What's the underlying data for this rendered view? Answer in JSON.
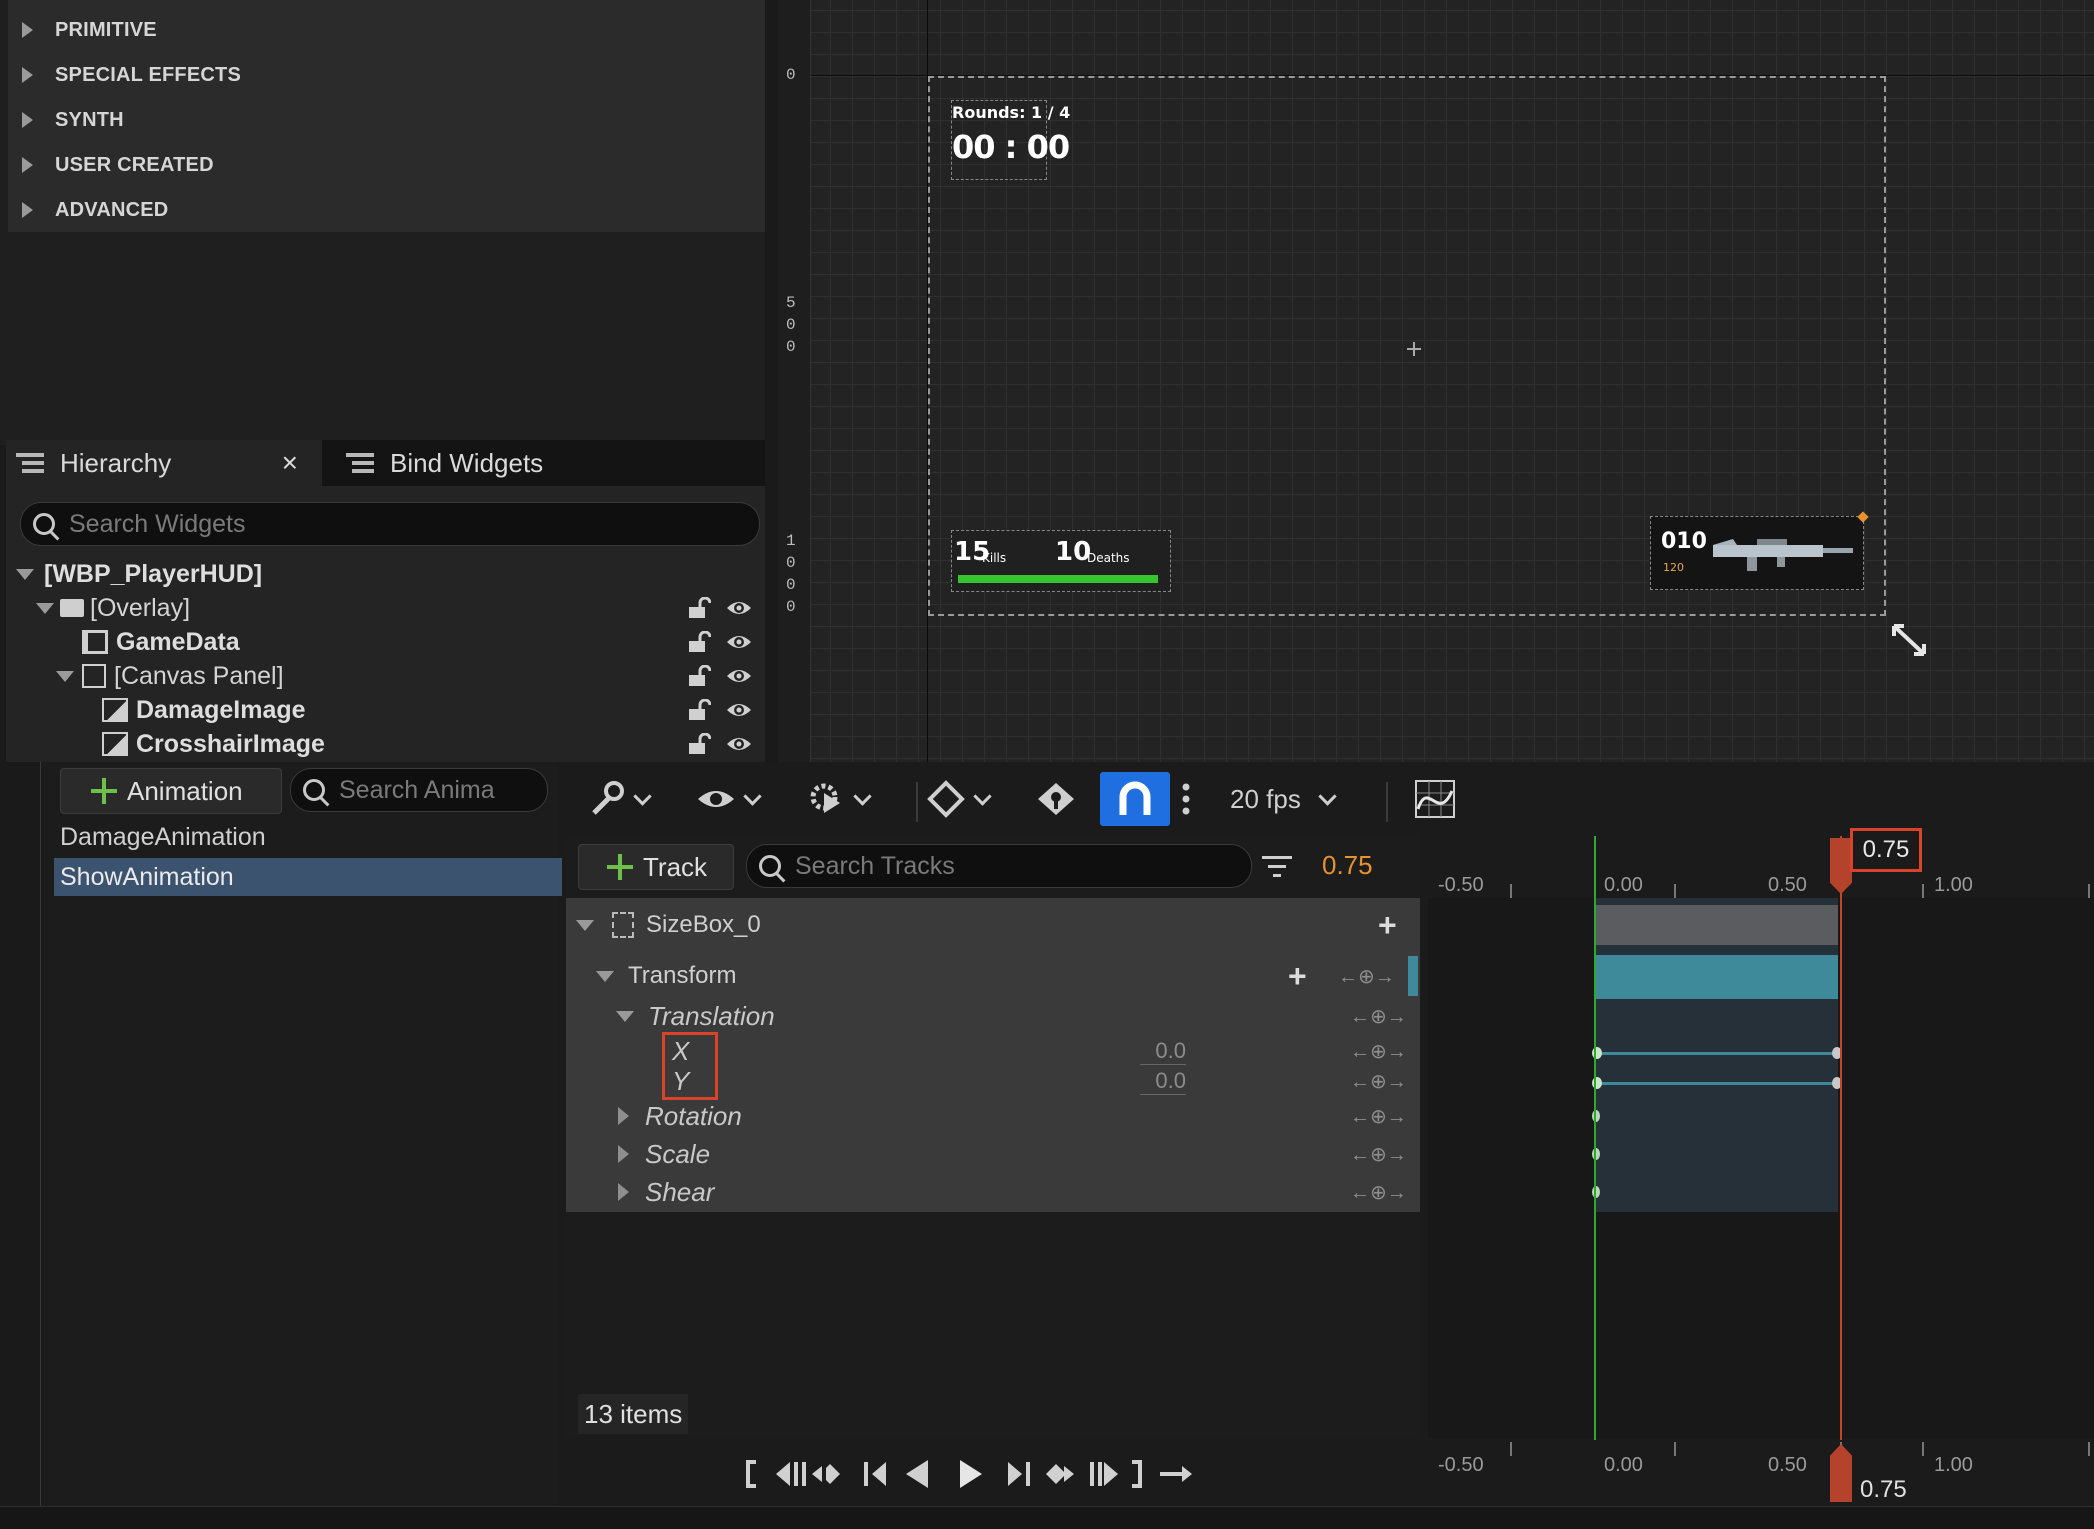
{
  "palette": {
    "categories": [
      "PRIMITIVE",
      "SPECIAL EFFECTS",
      "SYNTH",
      "USER CREATED",
      "ADVANCED"
    ]
  },
  "hierarchy": {
    "tabs": [
      {
        "label": "Hierarchy",
        "close": "×"
      },
      {
        "label": "Bind Widgets"
      }
    ],
    "search_placeholder": "Search Widgets",
    "tree": [
      {
        "label": "[WBP_PlayerHUD]"
      },
      {
        "label": "[Overlay]"
      },
      {
        "label": "GameData"
      },
      {
        "label": "[Canvas Panel]"
      },
      {
        "label": "DamageImage"
      },
      {
        "label": "CrosshairImage"
      }
    ]
  },
  "viewport": {
    "ruler_labels": {
      "zero": "0",
      "five_hundred": [
        "5",
        "0",
        "0"
      ],
      "thousand": [
        "1",
        "0",
        "0",
        "0"
      ]
    },
    "hud": {
      "rounds": "Rounds: 1 / 4",
      "timer": "00 : 00",
      "kills_num": "15",
      "kills_label": "Kills",
      "deaths_num": "10",
      "deaths_label": "Deaths",
      "ammo": "010",
      "ammo_reserve": "120",
      "health_fraction": 1.0
    }
  },
  "animations": {
    "add_button": "Animation",
    "search_placeholder": "Search Anima",
    "items": [
      "DamageAnimation",
      "ShowAnimation"
    ],
    "selected": "ShowAnimation"
  },
  "sequencer": {
    "fps": "20 fps",
    "add_track": "Track",
    "search_placeholder": "Search Tracks",
    "current_time": "0.75",
    "tracks": {
      "object": "SizeBox_0",
      "transform": "Transform",
      "translation": "Translation",
      "x_label": "X",
      "x_value": "0.0",
      "y_label": "Y",
      "y_value": "0.0",
      "rotation": "Rotation",
      "scale": "Scale",
      "shear": "Shear"
    },
    "item_count": "13 items",
    "timeline": {
      "labels": [
        "-0.50",
        "0.00",
        "0.50",
        "1.00"
      ],
      "playhead": "0.75",
      "playhead_bottom": "0.75"
    }
  },
  "colors": {
    "accent_blue": "#1f6fe0",
    "time_orange": "#e8912d",
    "playhead": "#c0452f",
    "selection": "#3c536f",
    "track_teal": "#3e8a9a",
    "highlight_red": "#d8432a"
  }
}
